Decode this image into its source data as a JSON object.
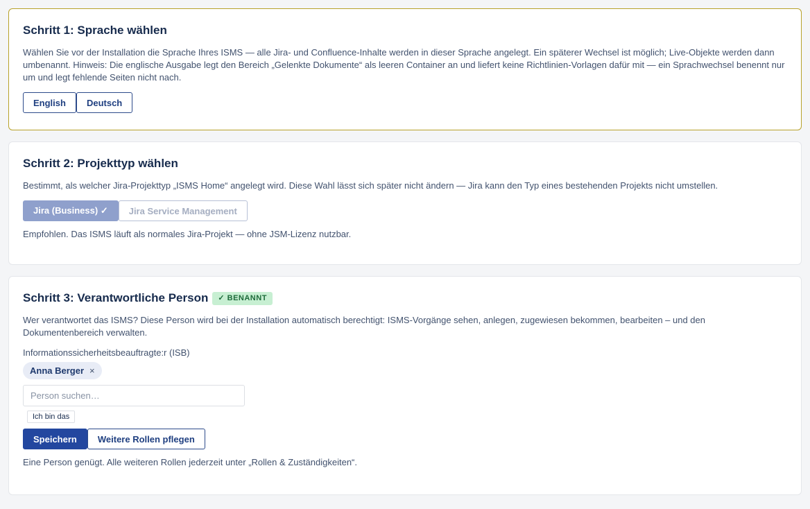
{
  "step1": {
    "title": "Schritt 1: Sprache wählen",
    "description": "Wählen Sie vor der Installation die Sprache Ihres ISMS — alle Jira- und Confluence-Inhalte werden in dieser Sprache angelegt. Ein späterer Wechsel ist möglich; Live-Objekte werden dann umbenannt. Hinweis: Die englische Ausgabe legt den Bereich „Gelenkte Dokumente“ als leeren Container an und liefert keine Richtlinien-Vorlagen dafür mit — ein Sprachwechsel benennt nur um und legt fehlende Seiten nicht nach.",
    "options": [
      "English",
      "Deutsch"
    ]
  },
  "step2": {
    "title": "Schritt 2: Projekttyp wählen",
    "description": "Bestimmt, als welcher Jira-Projekttyp „ISMS Home“ angelegt wird. Diese Wahl lässt sich später nicht ändern — Jira kann den Typ eines bestehenden Projekts nicht umstellen.",
    "option_business": "Jira (Business) ✓",
    "option_jsm": "Jira Service Management",
    "note": "Empfohlen. Das ISMS läuft als normales Jira-Projekt — ohne JSM-Lizenz nutzbar."
  },
  "step3": {
    "title": "Schritt 3: Verantwortliche Person",
    "badge": "✓ BENANNT",
    "description": "Wer verantwortet das ISMS? Diese Person wird bei der Installation automatisch berechtigt: ISMS-Vorgänge sehen, anlegen, zugewiesen bekommen, bearbeiten – und den Dokumentenbereich verwalten.",
    "role_label": "Informationssicherheitsbeauftragte:r (ISB)",
    "selected_person": "Anna Berger",
    "remove_symbol": "×",
    "search_placeholder": "Person suchen…",
    "self_button": "Ich bin das",
    "save_button": "Speichern",
    "more_roles_button": "Weitere Rollen pflegen",
    "note": "Eine Person genügt. Alle weiteren Rollen jederzeit unter „Rollen & Zuständigkeiten“."
  },
  "colors": {
    "active_border": "#b8a12a",
    "primary": "#23479f",
    "badge_bg": "#c7efd2",
    "badge_text": "#1e6b3b"
  }
}
